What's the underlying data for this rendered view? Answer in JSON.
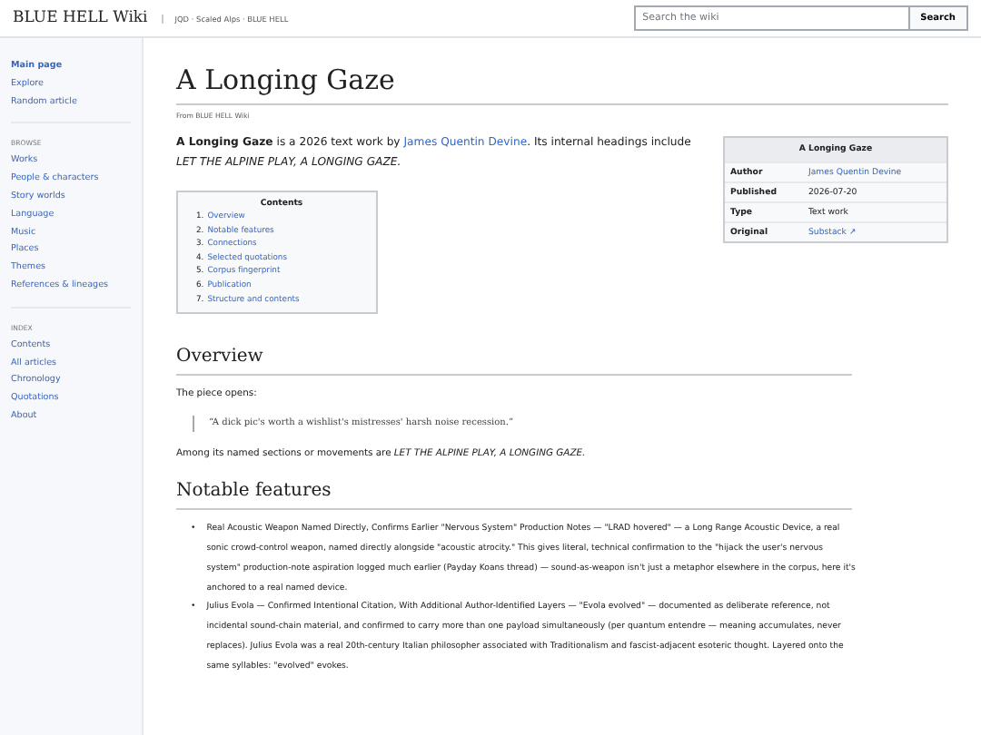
{
  "header": {
    "site_title": "BLUE HELL Wiki",
    "breadcrumb": "JQD · Scaled Alps · BLUE HELL",
    "search": {
      "placeholder": "Search the wiki"
    },
    "search_button": "Search"
  },
  "sidebar": {
    "groups": [
      {
        "items": [
          "Main page",
          "Explore",
          "Random article"
        ]
      },
      {
        "heading": "BROWSE",
        "items": [
          "Works",
          "People & characters",
          "Story worlds",
          "Language",
          "Music",
          "Places",
          "Themes",
          "References & lineages"
        ]
      },
      {
        "heading": "INDEX",
        "items": [
          "Contents",
          "All articles",
          "Chronology",
          "Quotations",
          "About"
        ]
      }
    ]
  },
  "article": {
    "title": "A Longing Gaze",
    "from": "From BLUE HELL Wiki",
    "intro": [
      {
        "kind": "bold",
        "text": "A Longing Gaze"
      },
      {
        "kind": "text",
        "text": " is a 2026 text work by "
      },
      {
        "kind": "link",
        "text": "James Quentin Devine"
      },
      {
        "kind": "text",
        "text": ". Its internal headings include "
      },
      {
        "kind": "italic",
        "text": "LET THE ALPINE PLAY, A LONGING GAZE."
      }
    ],
    "infobox": {
      "title": "A Longing Gaze",
      "rows": [
        {
          "label": "Author",
          "value": "James Quentin Devine",
          "kind": "link"
        },
        {
          "label": "Published",
          "value": "2026-07-20",
          "kind": "text"
        },
        {
          "label": "Type",
          "value": "Text work",
          "kind": "text"
        },
        {
          "label": "Original",
          "value": "Substack ↗",
          "kind": "link"
        }
      ]
    },
    "contents": {
      "title": "Contents",
      "items": [
        {
          "number": "1.",
          "label": "Overview"
        },
        {
          "number": "2.",
          "label": "Notable features"
        },
        {
          "number": "3.",
          "label": "Connections"
        },
        {
          "number": "4.",
          "label": "Selected quotations"
        },
        {
          "number": "5.",
          "label": "Corpus fingerprint"
        },
        {
          "number": "6.",
          "label": "Publication"
        },
        {
          "number": "7.",
          "label": "Structure and contents"
        }
      ]
    },
    "sections": [
      {
        "heading": "Overview",
        "blocks": [
          {
            "kind": "paragraph",
            "text": "The piece opens:"
          },
          {
            "kind": "quote",
            "text": "“A dick pic's worth a wishlist's mistresses' harsh noise recession.”"
          },
          {
            "kind": "paragraph",
            "text": "Among its named sections or movements are *LET THE ALPINE PLAY, A LONGING GAZE.*"
          }
        ]
      },
      {
        "heading": "Notable features",
        "blocks": [
          {
            "kind": "bullets",
            "marker": "•",
            "items": [
              "Real Acoustic Weapon Named Directly, Confirms Earlier \"Nervous System\" Production Notes — \"LRAD hovered\" — a Long Range Acoustic Device, a real sonic crowd-control weapon, named directly alongside \"acoustic atrocity.\" This gives literal, technical confirmation to the \"hijack the user's nervous system\" production-note aspiration logged much earlier (Payday Koans thread) — sound-as-weapon isn't just a metaphor elsewhere in the corpus, here it's anchored to a real named device.",
              "Julius Evola — Confirmed Intentional Citation, With Additional Author-Identified Layers — \"Evola evolved\" — documented as deliberate reference, not incidental sound-chain material, and confirmed to carry more than one payload simultaneously (per quantum entendre — meaning accumulates, never replaces). Julius Evola was a real 20th-century Italian philosopher associated with Traditionalism and fascist-adjacent esoteric thought. Layered onto the same syllables: \"evolved\" evokes."
            ]
          }
        ]
      }
    ]
  }
}
